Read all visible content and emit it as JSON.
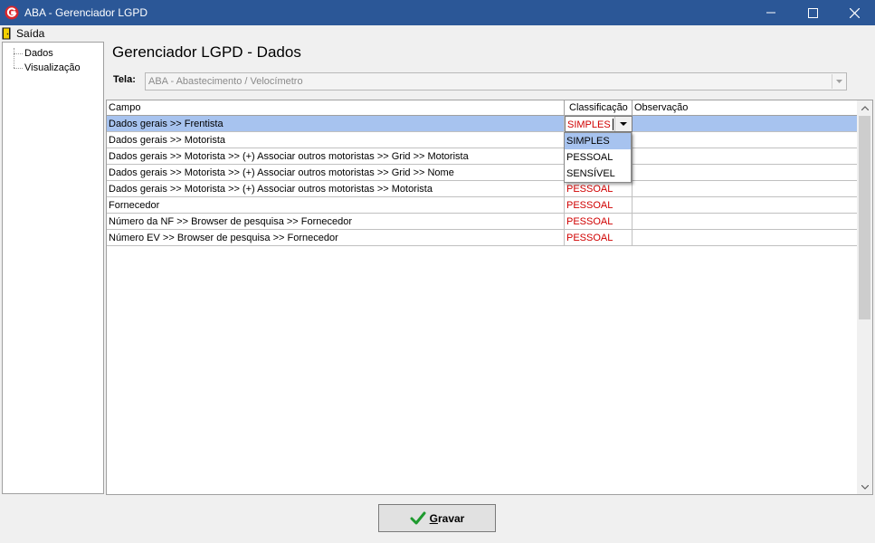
{
  "window": {
    "title": "ABA - Gerenciador LGPD",
    "minimize": "minimize",
    "maximize": "maximize",
    "close": "close"
  },
  "menu": {
    "saida_label": "Saída"
  },
  "tree": {
    "items": [
      "Dados",
      "Visualização"
    ]
  },
  "page": {
    "title": "Gerenciador LGPD - Dados"
  },
  "tela": {
    "label": "Tela:",
    "value": "ABA - Abastecimento / Velocímetro"
  },
  "grid": {
    "columns": [
      "Campo",
      "Classificação",
      "Observação"
    ],
    "rows": [
      {
        "campo": "Dados gerais >> Frentista",
        "classificacao": "SIMPLES",
        "observacao": ""
      },
      {
        "campo": "Dados gerais >> Motorista",
        "classificacao": "",
        "observacao": ""
      },
      {
        "campo": "Dados gerais >> Motorista >> (+) Associar outros motoristas >> Grid >> Motorista",
        "classificacao": "",
        "observacao": ""
      },
      {
        "campo": "Dados gerais >> Motorista >> (+) Associar outros motoristas >> Grid >> Nome",
        "classificacao": "",
        "observacao": ""
      },
      {
        "campo": "Dados gerais >> Motorista >> (+) Associar outros motoristas >> Motorista",
        "classificacao": "PESSOAL",
        "observacao": ""
      },
      {
        "campo": "Fornecedor",
        "classificacao": "PESSOAL",
        "observacao": ""
      },
      {
        "campo": "Número da NF >> Browser de pesquisa >> Fornecedor",
        "classificacao": "PESSOAL",
        "observacao": ""
      },
      {
        "campo": "Número EV >> Browser de pesquisa >> Fornecedor",
        "classificacao": "PESSOAL",
        "observacao": ""
      }
    ],
    "editor_value": "SIMPLES",
    "dropdown_options": [
      "SIMPLES",
      "PESSOAL",
      "SENSÍVEL"
    ],
    "dropdown_selected": "SIMPLES"
  },
  "buttons": {
    "gravar_first": "G",
    "gravar_rest": "ravar"
  },
  "colors": {
    "titlebar": "#2b5797",
    "selection": "#a7c3ef",
    "classification_text": "#d00000"
  }
}
